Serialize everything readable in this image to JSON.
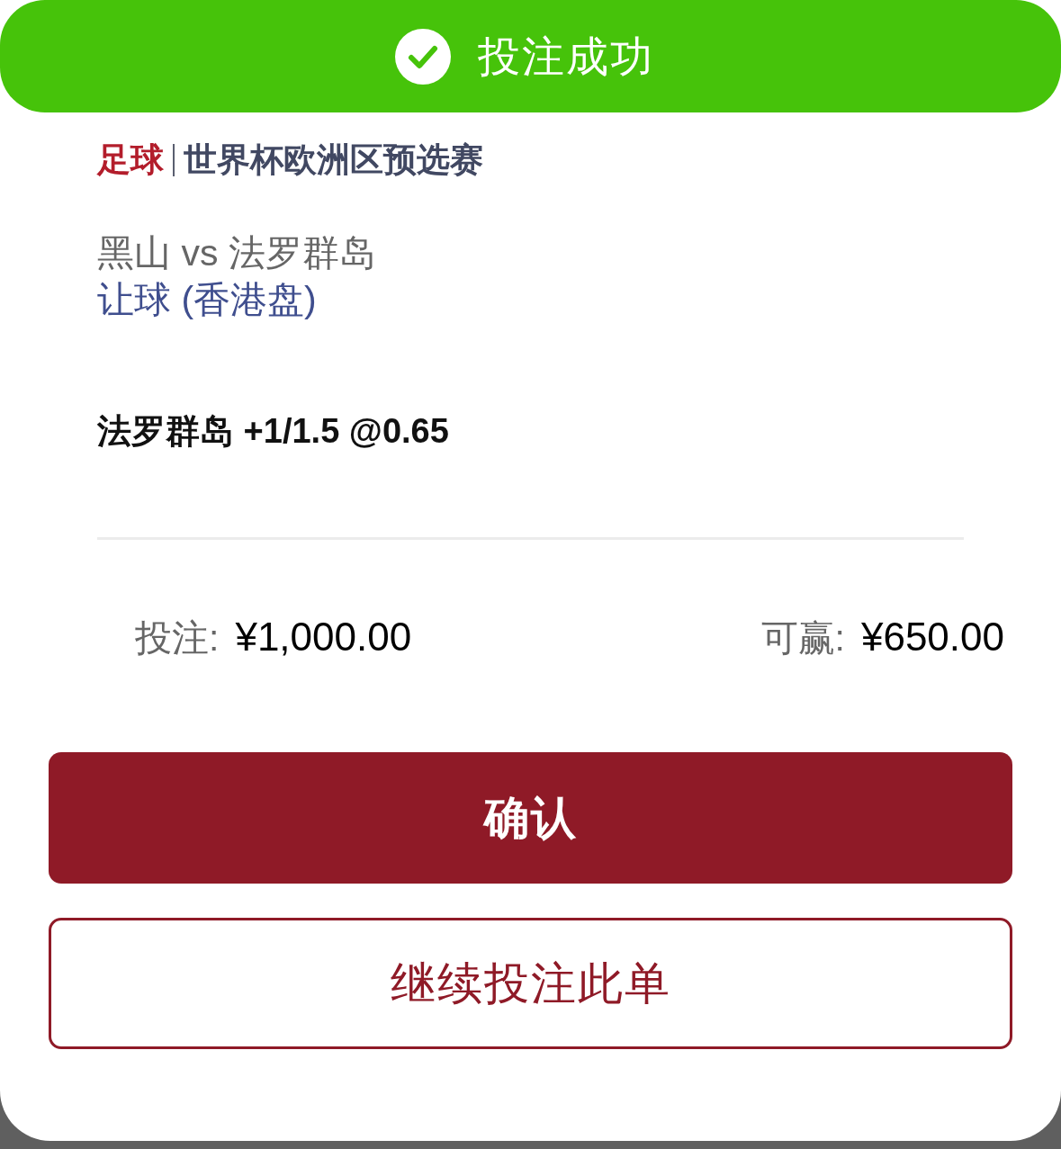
{
  "banner": {
    "title": "投注成功"
  },
  "match": {
    "sport": "足球",
    "league": "世界杯欧洲区预选赛",
    "teams": "黑山 vs 法罗群岛",
    "market": "让球 (香港盘)"
  },
  "selection": "法罗群岛 +1/1.5 @0.65",
  "summary": [
    {
      "label": "投注:",
      "amount": "¥1,000.00"
    },
    {
      "label": "可赢:",
      "amount": "¥650.00"
    }
  ],
  "buttons": [
    {
      "label": "确认",
      "kind": "primary"
    },
    {
      "label": "继续投注此单",
      "kind": "outline"
    }
  ]
}
